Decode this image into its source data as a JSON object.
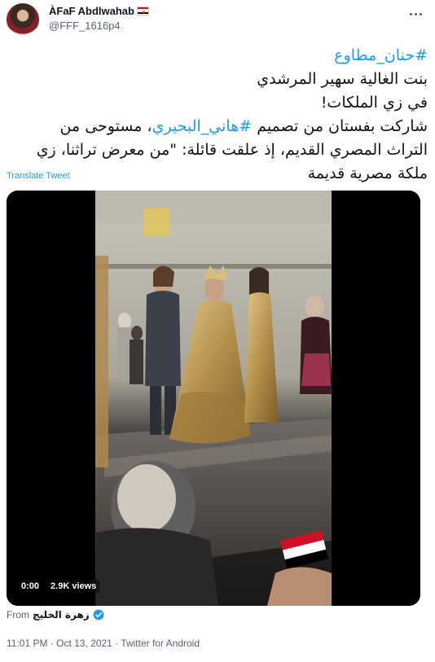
{
  "author": {
    "display_name": "ÀFaF Abdlwahab",
    "handle": "@FFF_1616p4"
  },
  "tweet": {
    "hashtag_line": "#حنان_مطاوع",
    "line2": "بنت الغالية سهير المرشدي",
    "line3": "في زي الملكات!",
    "line4_prefix": "شاركت بفستان من تصميم ",
    "line4_hashtag": "#هاني_البحيري",
    "line4_suffix": "، مستوحى من",
    "line5": "التراث المصري القديم، إذ علقت قائلة: \"من معرض تراثنا، زي",
    "line6": "ملكة مصرية قديمة"
  },
  "translate_label": "Translate Tweet",
  "video": {
    "time": "0:00",
    "views": "2.9K views"
  },
  "source": {
    "from_label": "From",
    "account_name": "زهرة الخليج"
  },
  "meta": {
    "timestamp": "11:01 PM · Oct 13, 2021 · Twitter for Android"
  },
  "colors": {
    "link": "#1d9bf0",
    "secondary_text": "#536471",
    "primary_text": "#0f1419"
  }
}
